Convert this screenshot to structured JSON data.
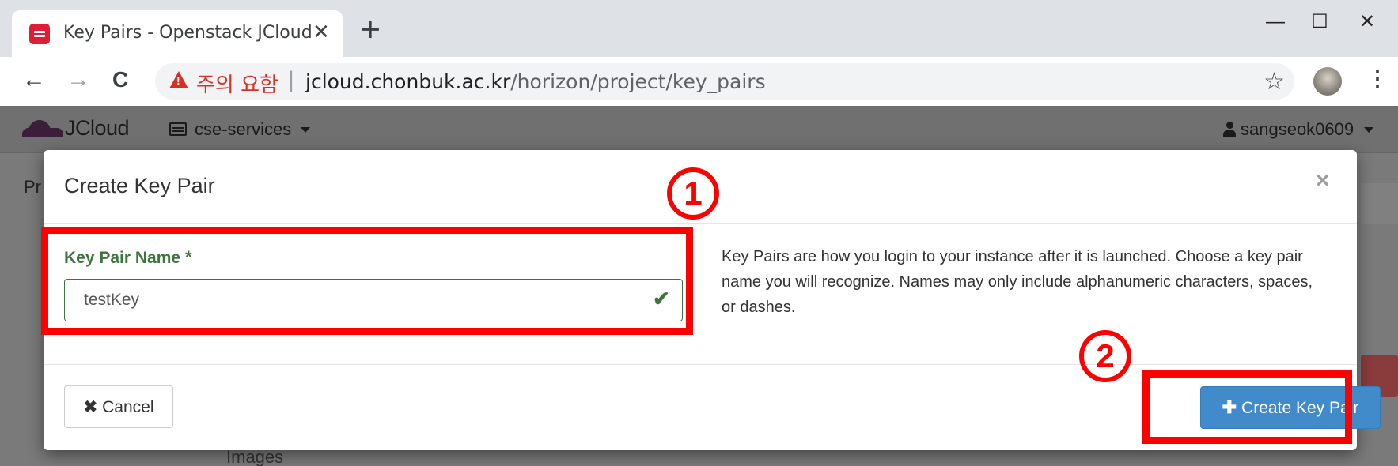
{
  "browser": {
    "tab_title": "Key Pairs - Openstack JCloud",
    "tab_close": "✕",
    "new_tab": "+",
    "window_controls": {
      "minimize": "—",
      "maximize": "☐",
      "close": "✕"
    },
    "nav": {
      "back": "←",
      "forward": "→",
      "reload": "C"
    },
    "security_label": "주의 요함",
    "url_host": "jcloud.chonbuk.ac.kr",
    "url_path": "/horizon/project/key_pairs",
    "separator": "|",
    "bookmark": "☆",
    "menu": "⋮"
  },
  "app": {
    "brand": "JCloud",
    "project": "cse-services",
    "user": "sangseok0609",
    "breadcrumb": "Pr",
    "background_label": "Images"
  },
  "modal": {
    "title": "Create Key Pair",
    "close": "×",
    "field_label": "Key Pair Name",
    "required_mark": "*",
    "field_value": "testKey",
    "check": "✔",
    "help_text": "Key Pairs are how you login to your instance after it is launched. Choose a key pair name you will recognize. Names may only include alphanumeric characters, spaces, or dashes.",
    "cancel_icon": "✖",
    "cancel_label": "Cancel",
    "create_icon": "✚",
    "create_label": "Create Key Pair"
  },
  "annotations": {
    "step1": "1",
    "step2": "2",
    "color": "#ff0000"
  },
  "colors": {
    "primary": "#428bca",
    "success": "#3c763d"
  }
}
